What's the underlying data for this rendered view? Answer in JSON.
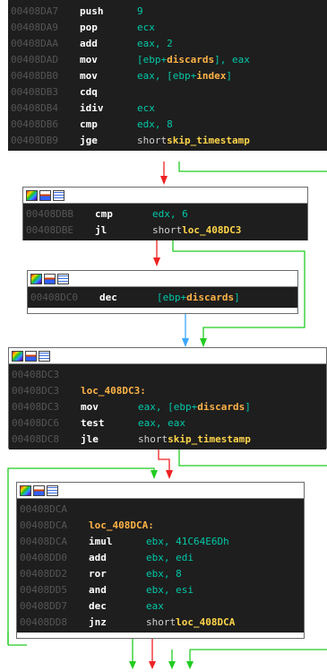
{
  "colors": {
    "branch_taken": "#22cc22",
    "branch_not_taken": "#ee2222",
    "unconditional": "#3aa7ff",
    "block_bg": "#1e1e1e",
    "header_bg": "#ffffff"
  },
  "header_icons": [
    "palette-icon",
    "chart-icon",
    "grid-icon"
  ],
  "blocks": [
    {
      "header": false,
      "lines": [
        {
          "addr": "00408DA7",
          "mn": "push",
          "op": [
            {
              "t": "9",
              "c": "num"
            }
          ]
        },
        {
          "addr": "00408DA9",
          "mn": "pop",
          "op": [
            {
              "t": "ecx",
              "c": "reg"
            }
          ]
        },
        {
          "addr": "00408DAA",
          "mn": "add",
          "op": [
            {
              "t": "eax, 2",
              "c": "reg"
            }
          ]
        },
        {
          "addr": "00408DAD",
          "mn": "mov",
          "op": [
            {
              "t": "[ebp+",
              "c": "reg"
            },
            {
              "t": "discards",
              "c": "var"
            },
            {
              "t": "], eax",
              "c": "reg"
            }
          ]
        },
        {
          "addr": "00408DB0",
          "mn": "mov",
          "op": [
            {
              "t": "eax, [ebp+",
              "c": "reg"
            },
            {
              "t": "index",
              "c": "var"
            },
            {
              "t": "]",
              "c": "reg"
            }
          ]
        },
        {
          "addr": "00408DB3",
          "mn": "cdq",
          "op": []
        },
        {
          "addr": "00408DB4",
          "mn": "idiv",
          "op": [
            {
              "t": "ecx",
              "c": "reg"
            }
          ]
        },
        {
          "addr": "00408DB6",
          "mn": "cmp",
          "op": [
            {
              "t": "edx, 8",
              "c": "reg"
            }
          ]
        },
        {
          "addr": "00408DB9",
          "mn": "jge",
          "op": [
            {
              "t": "short ",
              "c": "kw"
            },
            {
              "t": "skip_timestamp",
              "c": "tgt"
            }
          ]
        }
      ]
    },
    {
      "header": true,
      "lines": [
        {
          "addr": "00408DBB",
          "mn": "cmp",
          "op": [
            {
              "t": "edx, 6",
              "c": "reg"
            }
          ]
        },
        {
          "addr": "00408DBE",
          "mn": "jl",
          "op": [
            {
              "t": "short ",
              "c": "kw"
            },
            {
              "t": "loc_408DC3",
              "c": "tgt"
            }
          ]
        }
      ]
    },
    {
      "header": true,
      "lines": [
        {
          "addr": "00408DC0",
          "mn": "dec",
          "op": [
            {
              "t": "[ebp+",
              "c": "reg"
            },
            {
              "t": "discards",
              "c": "var"
            },
            {
              "t": "]",
              "c": "reg"
            }
          ]
        }
      ]
    },
    {
      "header": true,
      "lines": [
        {
          "addr": "00408DC3",
          "mn": "",
          "op": []
        },
        {
          "addr": "00408DC3",
          "label": "loc_408DC3:"
        },
        {
          "addr": "00408DC3",
          "mn": "mov",
          "op": [
            {
              "t": "eax, [ebp+",
              "c": "reg"
            },
            {
              "t": "discards",
              "c": "var"
            },
            {
              "t": "]",
              "c": "reg"
            }
          ]
        },
        {
          "addr": "00408DC6",
          "mn": "test",
          "op": [
            {
              "t": "eax, eax",
              "c": "reg"
            }
          ]
        },
        {
          "addr": "00408DC8",
          "mn": "jle",
          "op": [
            {
              "t": "short ",
              "c": "kw"
            },
            {
              "t": "skip_timestamp",
              "c": "tgt"
            }
          ]
        }
      ]
    },
    {
      "header": true,
      "lines": [
        {
          "addr": "00408DCA",
          "mn": "",
          "op": []
        },
        {
          "addr": "00408DCA",
          "label": "loc_408DCA:"
        },
        {
          "addr": "00408DCA",
          "mn": "imul",
          "op": [
            {
              "t": "ebx, 41C64E6Dh",
              "c": "reg"
            }
          ]
        },
        {
          "addr": "00408DD0",
          "mn": "add",
          "op": [
            {
              "t": "ebx, edi",
              "c": "reg"
            }
          ]
        },
        {
          "addr": "00408DD2",
          "mn": "ror",
          "op": [
            {
              "t": "ebx, 8",
              "c": "reg"
            }
          ]
        },
        {
          "addr": "00408DD5",
          "mn": "and",
          "op": [
            {
              "t": "ebx, esi",
              "c": "reg"
            }
          ]
        },
        {
          "addr": "00408DD7",
          "mn": "dec",
          "op": [
            {
              "t": "eax",
              "c": "reg"
            }
          ]
        },
        {
          "addr": "00408DD8",
          "mn": "jnz",
          "op": [
            {
              "t": "short ",
              "c": "kw"
            },
            {
              "t": "loc_408DCA",
              "c": "tgt"
            }
          ]
        }
      ]
    }
  ]
}
